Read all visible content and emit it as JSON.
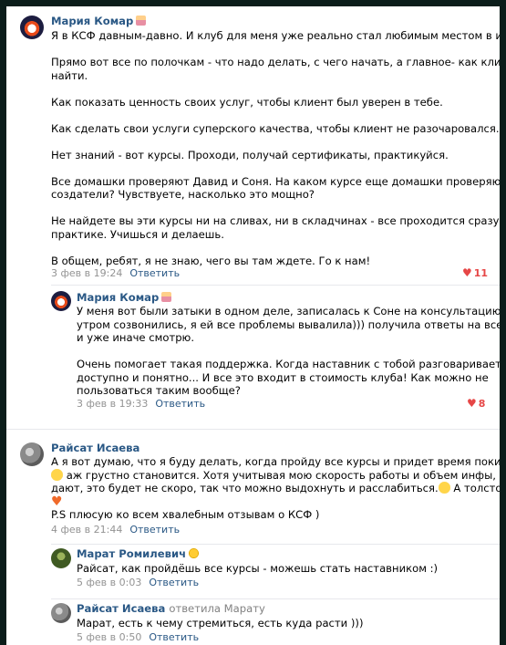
{
  "comments": [
    {
      "author": "Мария Комар",
      "paragraphs": [
        [
          "Я в КСФ давным-давно. И клуб для меня уже реально стал любимым местом в инете."
        ],
        [
          "Прямо вот все по полочкам - что надо делать, с чего начать, а главное- как клиентов",
          "найти."
        ],
        [
          "Как показать ценность своих услуг, чтобы клиент был уверен в тебе."
        ],
        [
          "Как сделать свои услуги суперского качества, чтобы клиент не разочаровался."
        ],
        [
          "Нет знаний - вот курсы. Проходи, получай сертификаты, практикуйся."
        ],
        [
          "Все домашки проверяют Давид и Соня. На каком курсе еще домашки проверяют их",
          "создатели? Чувствуете, насколько это мощно?"
        ],
        [
          "Не найдете вы эти курсы ни на сливах, ни в складчинах - все проходится сразу на",
          "практике. Учишься и делаешь."
        ],
        [
          "В общем, ребят, я не знаю, чего вы там ждете. Го к нам!"
        ]
      ],
      "time": "3 фев в 19:24",
      "reply_label": "Ответить",
      "likes": "11",
      "replies": [
        {
          "author": "Мария Комар",
          "paragraphs": [
            [
              "У меня вот были затыки в одном деле, записалась к Соне на консультацию, сегодня",
              "утром созвонились, я ей все проблемы вывалила))) получила ответы на все вопросы",
              "и уже иначе смотрю."
            ],
            [
              "Очень помогает такая поддержка. Когда наставник с тобой разговаривает, объясняет",
              "доступно и понятно... И все это входит в стоимость клуба! Как можно не",
              "пользоваться таким вообще?"
            ]
          ],
          "time": "3 фев в 19:33",
          "reply_label": "Ответить",
          "likes": "8"
        }
      ]
    },
    {
      "author": "Райсат Исаева",
      "lines": {
        "l1": "А я вот думаю, что я буду делать, когда пройду все курсы и придет время покидать клуб",
        "l2": "аж грустно становится. Хотя учитывая мою скорость работы и объем инфы, которую тут",
        "l3a": "дают, это будет не скоро, так что можно выдохнуть и расслабиться.",
        "l3b": "А толстовочка - это",
        "l5": "P.S плюсую ко всем хвалебным отзывам о КСФ )"
      },
      "time": "4 фев в 21:44",
      "reply_label": "Ответить",
      "replies": [
        {
          "author": "Марат Ромилевич",
          "text": "Райсат, как пройдёшь все курсы - можешь стать наставником :)",
          "time": "5 фев в 0:03",
          "reply_label": "Ответить"
        },
        {
          "author": "Райсат Исаева",
          "reply_to": "ответила Марату",
          "text": "Марат, есть к чему стремиться, есть куда расти )))",
          "time": "5 фев в 0:50",
          "reply_label": "Ответить"
        }
      ]
    }
  ],
  "icons": {
    "like": "heart-icon",
    "colors": {
      "link": "#2a5885",
      "like": "#e64646",
      "meta": "#939393"
    }
  }
}
